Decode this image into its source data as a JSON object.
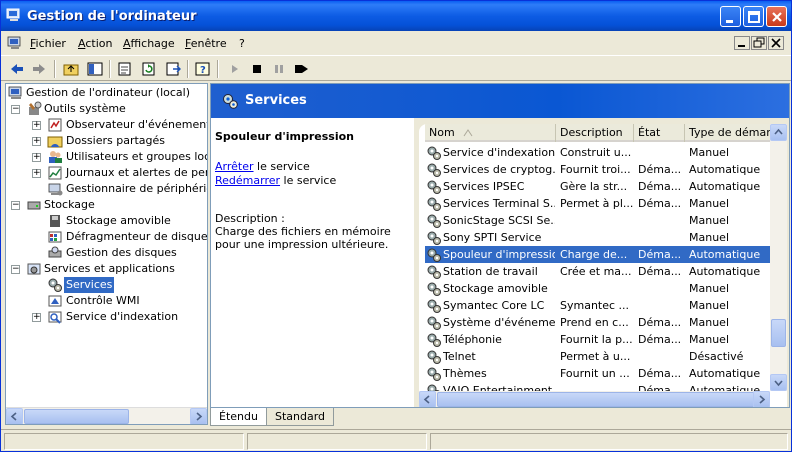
{
  "window": {
    "title": "Gestion de l'ordinateur"
  },
  "menu": {
    "items": [
      "Fichier",
      "Action",
      "Affichage",
      "Fenêtre",
      "?"
    ]
  },
  "tree": {
    "root": "Gestion de l'ordinateur (local)",
    "items": [
      "Outils système",
      "Observateur d'événements",
      "Dossiers partagés",
      "Utilisateurs et groupes locaux",
      "Journaux et alertes de performance",
      "Gestionnaire de périphériques",
      "Stockage",
      "Stockage amovible",
      "Défragmenteur de disque",
      "Gestion des disques",
      "Services et applications",
      "Services",
      "Contrôle WMI",
      "Service d'indexation"
    ]
  },
  "header": {
    "title": "Services"
  },
  "details": {
    "service_name": "Spouleur d'impression",
    "stop_link": "Arrêter",
    "stop_suffix": " le service",
    "restart_link": "Redémarrer",
    "restart_suffix": " le service",
    "description_label": "Description :",
    "description_text": "Charge des fichiers en mémoire pour une impression ultérieure."
  },
  "list": {
    "columns": [
      "Nom",
      "Description",
      "État",
      "Type de démarrage"
    ],
    "rows": [
      {
        "name": "Service d'indexation",
        "desc": "Construit u...",
        "state": "",
        "type": "Manuel"
      },
      {
        "name": "Services de cryptog...",
        "desc": "Fournit troi...",
        "state": "Déma...",
        "type": "Automatique"
      },
      {
        "name": "Services IPSEC",
        "desc": "Gère la str...",
        "state": "Déma...",
        "type": "Automatique"
      },
      {
        "name": "Services Terminal S...",
        "desc": "Permet à pl...",
        "state": "Déma...",
        "type": "Manuel"
      },
      {
        "name": "SonicStage SCSI Se...",
        "desc": "",
        "state": "",
        "type": "Manuel"
      },
      {
        "name": "Sony SPTI Service",
        "desc": "",
        "state": "",
        "type": "Manuel"
      },
      {
        "name": "Spouleur d'impression",
        "desc": "Charge de...",
        "state": "Déma...",
        "type": "Automatique"
      },
      {
        "name": "Station de travail",
        "desc": "Crée et ma...",
        "state": "Déma...",
        "type": "Automatique"
      },
      {
        "name": "Stockage amovible",
        "desc": "",
        "state": "",
        "type": "Manuel"
      },
      {
        "name": "Symantec Core LC",
        "desc": "Symantec ...",
        "state": "",
        "type": "Manuel"
      },
      {
        "name": "Système d'événeme...",
        "desc": "Prend en c...",
        "state": "Déma...",
        "type": "Manuel"
      },
      {
        "name": "Téléphonie",
        "desc": "Fournit la p...",
        "state": "Déma...",
        "type": "Manuel"
      },
      {
        "name": "Telnet",
        "desc": "Permet à u...",
        "state": "",
        "type": "Désactivé"
      },
      {
        "name": "Thèmes",
        "desc": "Fournit un ...",
        "state": "Déma...",
        "type": "Automatique"
      },
      {
        "name": "VAIO Entertainment ...",
        "desc": "",
        "state": "Déma...",
        "type": "Automatique"
      }
    ]
  },
  "tabs": [
    "Étendu",
    "Standard"
  ],
  "colors": {
    "accent": "#0a5ed8",
    "selection": "#316ac5"
  }
}
